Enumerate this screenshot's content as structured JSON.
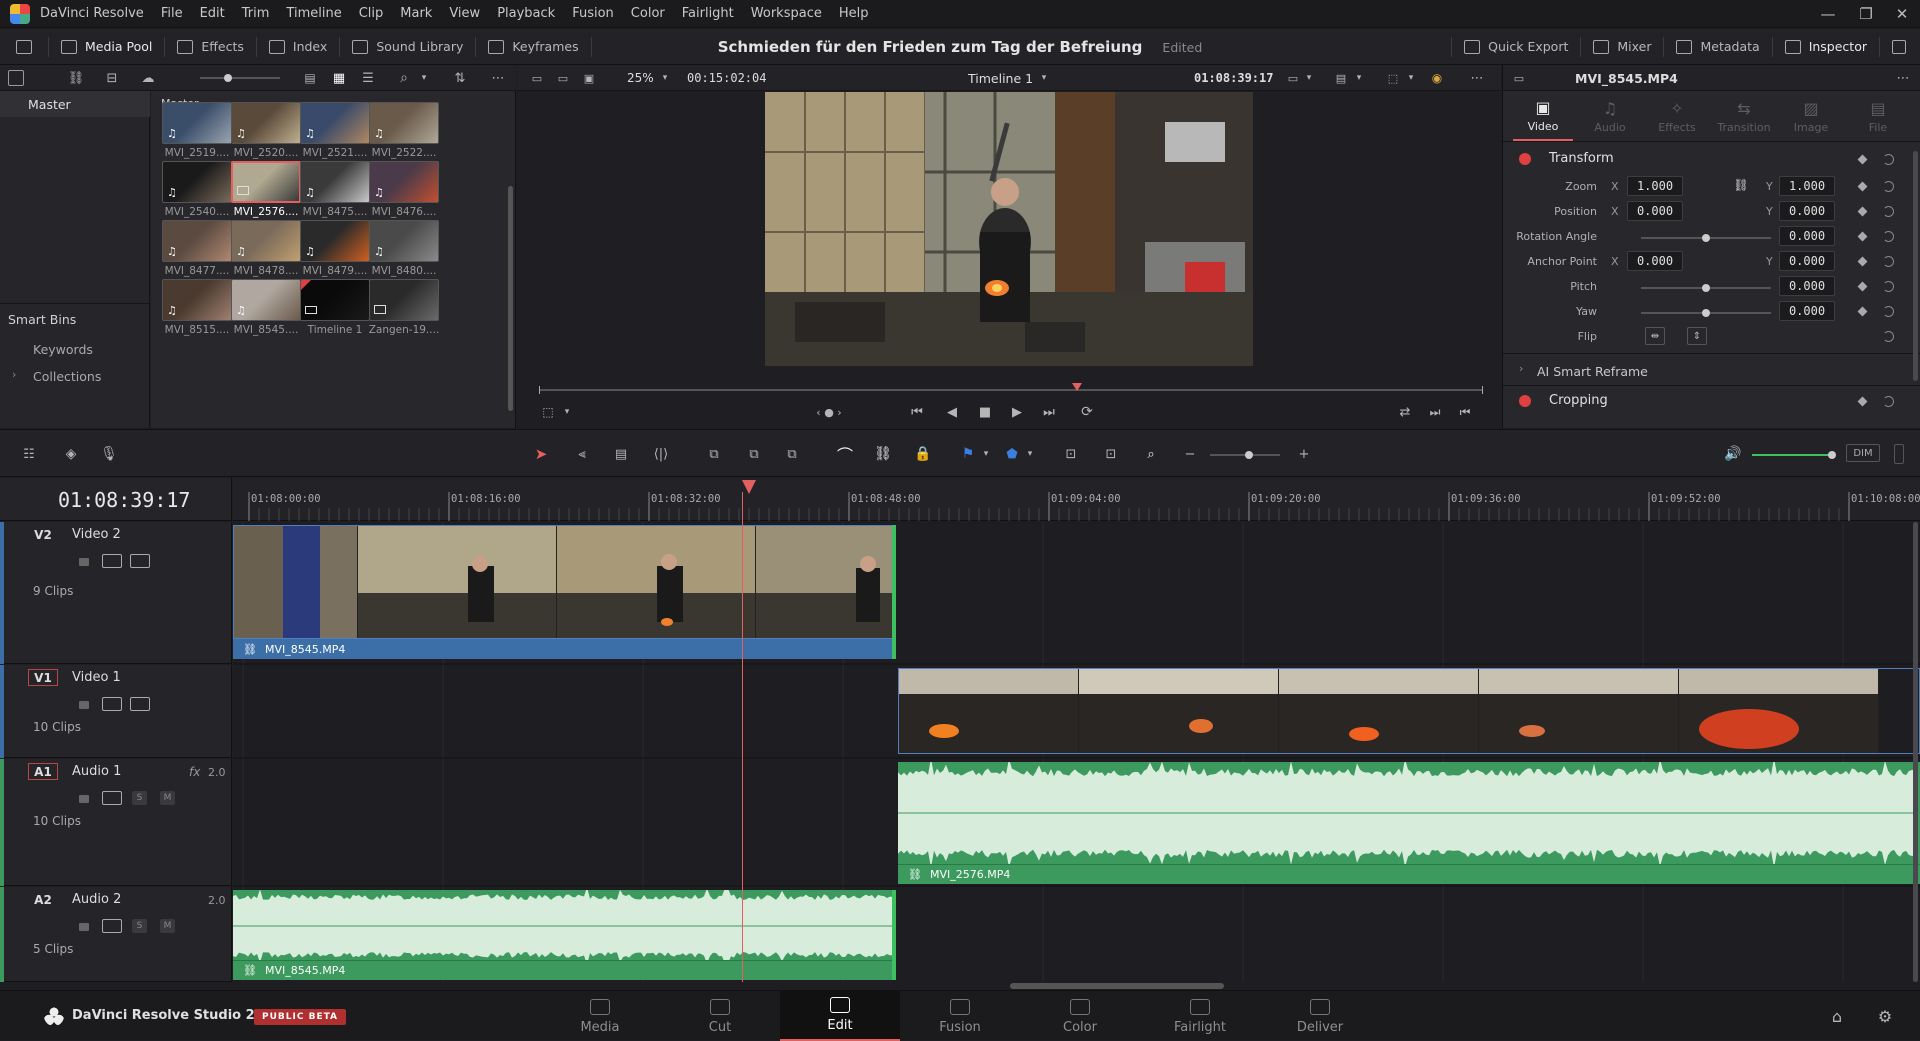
{
  "app": {
    "name": "DaVinci Resolve"
  },
  "menu": [
    "DaVinci Resolve",
    "File",
    "Edit",
    "Trim",
    "Timeline",
    "Clip",
    "Mark",
    "View",
    "Playback",
    "Fusion",
    "Color",
    "Fairlight",
    "Workspace",
    "Help"
  ],
  "toolbar": {
    "left": [
      {
        "label": "Media Pool",
        "icon": "media-pool-icon"
      },
      {
        "label": "Effects",
        "icon": "effects-icon"
      },
      {
        "label": "Index",
        "icon": "index-icon"
      },
      {
        "label": "Sound Library",
        "icon": "sound-library-icon"
      },
      {
        "label": "Keyframes",
        "icon": "keyframes-icon"
      }
    ],
    "right": [
      {
        "label": "Quick Export",
        "icon": "export-icon"
      },
      {
        "label": "Mixer",
        "icon": "mixer-icon"
      },
      {
        "label": "Metadata",
        "icon": "metadata-icon"
      },
      {
        "label": "Inspector",
        "icon": "inspector-icon"
      }
    ],
    "project_title": "Schmieden für den Frieden zum Tag der Befreiung",
    "project_status": "Edited"
  },
  "media_pool": {
    "sidebar": {
      "master": "Master",
      "smart_bins": "Smart Bins",
      "items": [
        "Keywords",
        "Collections"
      ]
    },
    "breadcrumb": "Master",
    "clips": [
      {
        "label": "MVI_2519....",
        "type": "av",
        "c1": "#3a4e6a",
        "c2": "#9aa4b0"
      },
      {
        "label": "MVI_2520....",
        "type": "av",
        "c1": "#5a4a3a",
        "c2": "#c0b090"
      },
      {
        "label": "MVI_2521....",
        "type": "av",
        "c1": "#3a4a6a",
        "c2": "#b08860"
      },
      {
        "label": "MVI_2522....",
        "type": "av",
        "c1": "#6a5a4a",
        "c2": "#b0a898"
      },
      {
        "label": "MVI_2540....",
        "type": "audio",
        "c1": "#1a1a1a",
        "c2": "#7a6a5a"
      },
      {
        "label": "MVI_2576....",
        "type": "video",
        "c1": "#b0a890",
        "c2": "#3a3a3a",
        "selected": true
      },
      {
        "label": "MVI_8475....",
        "type": "av",
        "c1": "#3a3a3a",
        "c2": "#c8c8c8"
      },
      {
        "label": "MVI_8476....",
        "type": "av",
        "c1": "#4a3a4a",
        "c2": "#c05030"
      },
      {
        "label": "MVI_8477....",
        "type": "av",
        "c1": "#5a4a40",
        "c2": "#b08870"
      },
      {
        "label": "MVI_8478....",
        "type": "av",
        "c1": "#7a6a5a",
        "c2": "#c0a070"
      },
      {
        "label": "MVI_8479....",
        "type": "av",
        "c1": "#2a2a2a",
        "c2": "#d06020"
      },
      {
        "label": "MVI_8480....",
        "type": "av",
        "c1": "#4a4a4a",
        "c2": "#8a8a8a"
      },
      {
        "label": "MVI_8515....",
        "type": "av",
        "c1": "#4a3a30",
        "c2": "#a08070"
      },
      {
        "label": "MVI_8545....",
        "type": "av",
        "c1": "#b0a8a0",
        "c2": "#6a5a4a"
      },
      {
        "label": "Timeline 1",
        "type": "timeline",
        "c1": "#0a0a0a",
        "c2": "#1a1a1a"
      },
      {
        "label": "Zangen-19....",
        "type": "image",
        "c1": "#2a2a2a",
        "c2": "#6a6a6a"
      }
    ]
  },
  "viewer": {
    "zoom": "25%",
    "source_timecode": "00:15:02:04",
    "timeline_name": "Timeline 1",
    "record_timecode": "01:08:39:17",
    "playhead_fraction": 0.57
  },
  "inspector": {
    "clip_name": "MVI_8545.MP4",
    "tabs": [
      {
        "label": "Video",
        "active": true
      },
      {
        "label": "Audio",
        "active": false
      },
      {
        "label": "Effects",
        "active": false
      },
      {
        "label": "Transition",
        "active": false
      },
      {
        "label": "Image",
        "active": false
      },
      {
        "label": "File",
        "active": false
      }
    ],
    "transform_title": "Transform",
    "zoom": {
      "label": "Zoom",
      "x": "1.000",
      "y": "1.000"
    },
    "position": {
      "label": "Position",
      "x": "0.000",
      "y": "0.000"
    },
    "rotation": {
      "label": "Rotation Angle",
      "value": "0.000"
    },
    "anchor": {
      "label": "Anchor Point",
      "x": "0.000",
      "y": "0.000"
    },
    "pitch": {
      "label": "Pitch",
      "value": "0.000"
    },
    "yaw": {
      "label": "Yaw",
      "value": "0.000"
    },
    "flip": {
      "label": "Flip"
    },
    "axis_x": "X",
    "axis_y": "Y",
    "ai_reframe": "AI Smart Reframe",
    "cropping": "Cropping"
  },
  "timeline": {
    "timecode": "01:08:39:17",
    "ruler": [
      "01:08:00:00",
      "01:08:16:00",
      "01:08:32:00",
      "01:08:48:00",
      "01:09:04:00",
      "01:09:20:00",
      "01:09:36:00",
      "01:09:52:00",
      "01:10:08:00"
    ],
    "tracks": [
      {
        "id": "V2",
        "name": "Video 2",
        "clips": "9 Clips"
      },
      {
        "id": "V1",
        "name": "Video 1",
        "clips": "10 Clips"
      },
      {
        "id": "A1",
        "name": "Audio 1",
        "clips": "10 Clips",
        "fx": "fx",
        "ch": "2.0"
      },
      {
        "id": "A2",
        "name": "Audio 2",
        "clips": "5 Clips",
        "ch": "2.0"
      }
    ],
    "v2_clip": "MVI_8545.MP4",
    "a1_clip": "MVI_2576.MP4",
    "a2_clip": "MVI_8545.MP4",
    "dim": "DIM",
    "solo": "S",
    "mute": "M"
  },
  "branding": {
    "product": "DaVinci Resolve Studio 20",
    "badge": "PUBLIC BETA"
  },
  "pages": [
    {
      "label": "Media"
    },
    {
      "label": "Cut"
    },
    {
      "label": "Edit",
      "active": true
    },
    {
      "label": "Fusion"
    },
    {
      "label": "Color"
    },
    {
      "label": "Fairlight"
    },
    {
      "label": "Deliver"
    }
  ],
  "colors": {
    "accent": "#e46060",
    "clip_blue": "#3c6fa8",
    "audio_green": "#3c9a5e",
    "selection": "#e46060"
  }
}
